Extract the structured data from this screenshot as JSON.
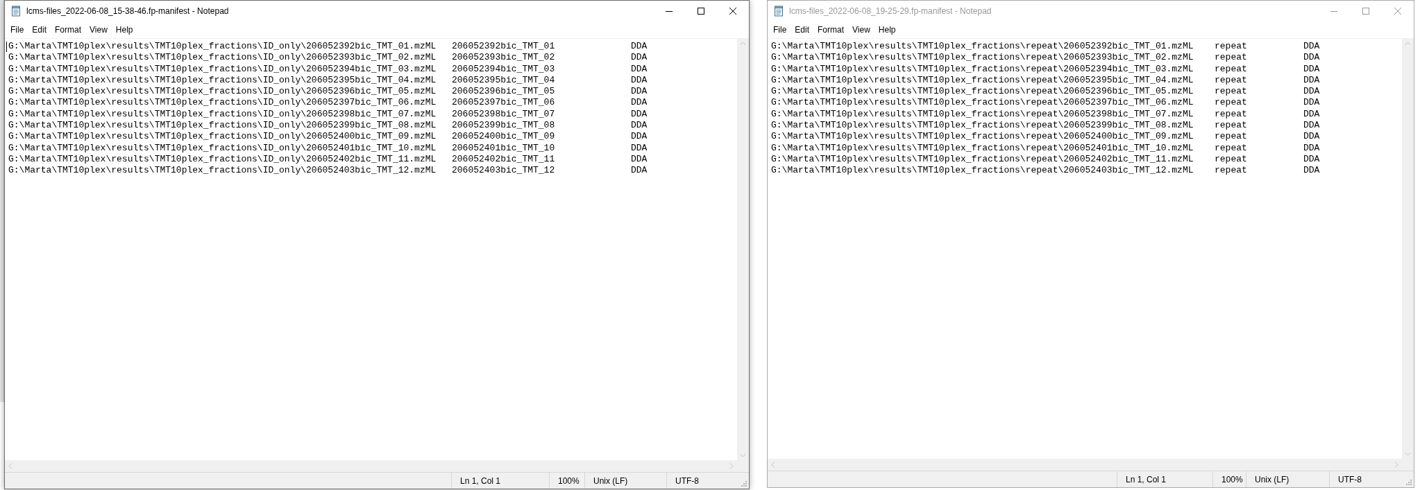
{
  "windows": [
    {
      "title": "lcms-files_2022-06-08_15-38-46.fp-manifest - Notepad",
      "active": true,
      "menu": [
        "File",
        "Edit",
        "Format",
        "View",
        "Help"
      ],
      "lines": [
        [
          "G:\\Marta\\TMT10plex\\results\\TMT10plex_fractions\\ID_only\\206052392bic_TMT_01.mzML",
          "206052392bic_TMT_01",
          "DDA"
        ],
        [
          "G:\\Marta\\TMT10plex\\results\\TMT10plex_fractions\\ID_only\\206052393bic_TMT_02.mzML",
          "206052393bic_TMT_02",
          "DDA"
        ],
        [
          "G:\\Marta\\TMT10plex\\results\\TMT10plex_fractions\\ID_only\\206052394bic_TMT_03.mzML",
          "206052394bic_TMT_03",
          "DDA"
        ],
        [
          "G:\\Marta\\TMT10plex\\results\\TMT10plex_fractions\\ID_only\\206052395bic_TMT_04.mzML",
          "206052395bic_TMT_04",
          "DDA"
        ],
        [
          "G:\\Marta\\TMT10plex\\results\\TMT10plex_fractions\\ID_only\\206052396bic_TMT_05.mzML",
          "206052396bic_TMT_05",
          "DDA"
        ],
        [
          "G:\\Marta\\TMT10plex\\results\\TMT10plex_fractions\\ID_only\\206052397bic_TMT_06.mzML",
          "206052397bic_TMT_06",
          "DDA"
        ],
        [
          "G:\\Marta\\TMT10plex\\results\\TMT10plex_fractions\\ID_only\\206052398bic_TMT_07.mzML",
          "206052398bic_TMT_07",
          "DDA"
        ],
        [
          "G:\\Marta\\TMT10plex\\results\\TMT10plex_fractions\\ID_only\\206052399bic_TMT_08.mzML",
          "206052399bic_TMT_08",
          "DDA"
        ],
        [
          "G:\\Marta\\TMT10plex\\results\\TMT10plex_fractions\\ID_only\\206052400bic_TMT_09.mzML",
          "206052400bic_TMT_09",
          "DDA"
        ],
        [
          "G:\\Marta\\TMT10plex\\results\\TMT10plex_fractions\\ID_only\\206052401bic_TMT_10.mzML",
          "206052401bic_TMT_10",
          "DDA"
        ],
        [
          "G:\\Marta\\TMT10plex\\results\\TMT10plex_fractions\\ID_only\\206052402bic_TMT_11.mzML",
          "206052402bic_TMT_11",
          "DDA"
        ],
        [
          "G:\\Marta\\TMT10plex\\results\\TMT10plex_fractions\\ID_only\\206052403bic_TMT_12.mzML",
          "206052403bic_TMT_12",
          "DDA"
        ]
      ],
      "status_bar": [
        "Ln 1, Col 1",
        "100%",
        "Unix (LF)",
        "UTF-8"
      ]
    },
    {
      "title": "lcms-files_2022-06-08_19-25-29.fp-manifest - Notepad",
      "active": false,
      "menu": [
        "File",
        "Edit",
        "Format",
        "View",
        "Help"
      ],
      "lines": [
        [
          "G:\\Marta\\TMT10plex\\results\\TMT10plex_fractions\\repeat\\206052392bic_TMT_01.mzML",
          "repeat",
          "DDA"
        ],
        [
          "G:\\Marta\\TMT10plex\\results\\TMT10plex_fractions\\repeat\\206052393bic_TMT_02.mzML",
          "repeat",
          "DDA"
        ],
        [
          "G:\\Marta\\TMT10plex\\results\\TMT10plex_fractions\\repeat\\206052394bic_TMT_03.mzML",
          "repeat",
          "DDA"
        ],
        [
          "G:\\Marta\\TMT10plex\\results\\TMT10plex_fractions\\repeat\\206052395bic_TMT_04.mzML",
          "repeat",
          "DDA"
        ],
        [
          "G:\\Marta\\TMT10plex\\results\\TMT10plex_fractions\\repeat\\206052396bic_TMT_05.mzML",
          "repeat",
          "DDA"
        ],
        [
          "G:\\Marta\\TMT10plex\\results\\TMT10plex_fractions\\repeat\\206052397bic_TMT_06.mzML",
          "repeat",
          "DDA"
        ],
        [
          "G:\\Marta\\TMT10plex\\results\\TMT10plex_fractions\\repeat\\206052398bic_TMT_07.mzML",
          "repeat",
          "DDA"
        ],
        [
          "G:\\Marta\\TMT10plex\\results\\TMT10plex_fractions\\repeat\\206052399bic_TMT_08.mzML",
          "repeat",
          "DDA"
        ],
        [
          "G:\\Marta\\TMT10plex\\results\\TMT10plex_fractions\\repeat\\206052400bic_TMT_09.mzML",
          "repeat",
          "DDA"
        ],
        [
          "G:\\Marta\\TMT10plex\\results\\TMT10plex_fractions\\repeat\\206052401bic_TMT_10.mzML",
          "repeat",
          "DDA"
        ],
        [
          "G:\\Marta\\TMT10plex\\results\\TMT10plex_fractions\\repeat\\206052402bic_TMT_11.mzML",
          "repeat",
          "DDA"
        ],
        [
          "G:\\Marta\\TMT10plex\\results\\TMT10plex_fractions\\repeat\\206052403bic_TMT_12.mzML",
          "repeat",
          "DDA"
        ]
      ],
      "status_bar": [
        "Ln 1, Col 1",
        "100%",
        "Unix (LF)",
        "UTF-8"
      ]
    }
  ]
}
